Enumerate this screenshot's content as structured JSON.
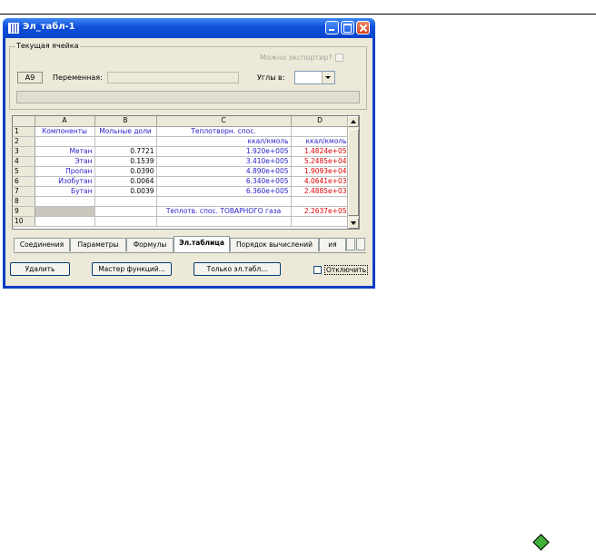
{
  "window": {
    "title": "Эл_табл-1"
  },
  "current_cell": {
    "group_label": "Текущая ячейка",
    "exportable_label": "Можно экспортир?",
    "cell_ref": "A9",
    "variable_label": "Переменная:",
    "variable_value": "",
    "angles_label": "Углы в:",
    "angles_value": "",
    "formula": ""
  },
  "grid": {
    "columns": [
      "A",
      "B",
      "C",
      "D"
    ],
    "rows": [
      {
        "n": "1",
        "a": "Компоненты",
        "b": "Мольные доли",
        "c": "Теплотворн. спос.",
        "d": ""
      },
      {
        "n": "2",
        "a": "",
        "b": "",
        "c": "ккал/кмоль",
        "d": "ккал/кмоль"
      },
      {
        "n": "3",
        "a": "Метан",
        "b": "0.7721",
        "c": "1.920e+005",
        "d": "1.4824e+05"
      },
      {
        "n": "4",
        "a": "Этан",
        "b": "0.1539",
        "c": "3.410e+005",
        "d": "5.2485e+04"
      },
      {
        "n": "5",
        "a": "Пропан",
        "b": "0.0390",
        "c": "4.890e+005",
        "d": "1.9093e+04"
      },
      {
        "n": "6",
        "a": "Изобутан",
        "b": "0.0064",
        "c": "6.340e+005",
        "d": "4.0641e+03"
      },
      {
        "n": "7",
        "a": "Бутан",
        "b": "0.0039",
        "c": "6.360e+005",
        "d": "2.4885e+03"
      },
      {
        "n": "8",
        "a": "",
        "b": "",
        "c": "",
        "d": ""
      },
      {
        "n": "9",
        "a": "",
        "b": "",
        "c": "Теплотв. спос. ТОВАРНОГО газа",
        "d": "2.2637e+05"
      },
      {
        "n": "10",
        "a": "",
        "b": "",
        "c": "",
        "d": ""
      }
    ]
  },
  "tabs": {
    "items": [
      "Соединения",
      "Параметры",
      "Формулы",
      "Эл.таблица",
      "Порядок вычислений",
      "ия"
    ],
    "active": "Эл.таблица"
  },
  "buttons": {
    "delete": "Удалить",
    "function_wizard": "Мастер функций...",
    "sheet_only": "Только эл.табл...",
    "disable": "Отключить"
  },
  "icons": {
    "app": "spreadsheet-grid-icon",
    "status": "green-diamond-icon"
  },
  "colors": {
    "title_bar": "#0a3cc4",
    "text_blue": "#2a22c8",
    "text_red": "#e00000",
    "status_diamond": "#3fae3a"
  }
}
